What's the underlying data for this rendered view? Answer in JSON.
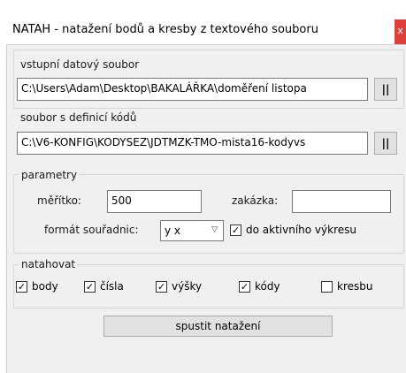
{
  "window": {
    "title": "NATAH - natažení bodů a kresby z textového souboru",
    "close_label": "x"
  },
  "input_file": {
    "label": "vstupní datový soubor",
    "value": "C:\\Users\\Adam\\Desktop\\BAKALÁŘKA\\doměření listopa",
    "browse_label": "||"
  },
  "codes_file": {
    "label": "soubor s definicí kódů",
    "value": "C:\\V6-KONFIG\\KODYSEZ\\JDTMZK-TMO-mista16-kodyvs",
    "browse_label": "||"
  },
  "params": {
    "group_label": "parametry",
    "scale_label": "měřítko:",
    "scale_value": "500",
    "order_label": "zakázka:",
    "order_value": "",
    "coord_format_label": "formát souřadnic:",
    "coord_format_value": "y x",
    "active_drawing_label": "do aktivního výkresu",
    "active_drawing_checked": true
  },
  "pull": {
    "group_label": "natahovat",
    "options": [
      {
        "label": "body",
        "checked": true
      },
      {
        "label": "čísla",
        "checked": true
      },
      {
        "label": "výšky",
        "checked": true
      },
      {
        "label": "kódy",
        "checked": true
      },
      {
        "label": "kresbu",
        "checked": false
      }
    ]
  },
  "run_button": "spustit natažení",
  "icons": {
    "close": "close-icon",
    "dropdown": "chevron-down-icon",
    "check": "check-icon"
  }
}
